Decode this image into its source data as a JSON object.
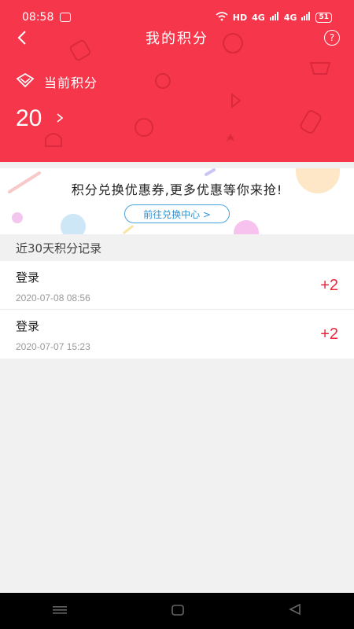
{
  "status_bar": {
    "time": "08:58",
    "network": "HD",
    "signal1": "4G",
    "signal2": "4G",
    "battery": "51"
  },
  "nav": {
    "title": "我的积分",
    "help": "?"
  },
  "points": {
    "label": "当前积分",
    "value": "20"
  },
  "banner": {
    "text": "积分兑换优惠券,更多优惠等你来抢!",
    "button": "前往兑换中心 >"
  },
  "records": {
    "section_title": "近30天积分记录",
    "items": [
      {
        "title": "登录",
        "time": "2020-07-08 08:56",
        "delta": "+2"
      },
      {
        "title": "登录",
        "time": "2020-07-07 15:23",
        "delta": "+2"
      }
    ]
  },
  "colors": {
    "header_bg": "#f6374b",
    "accent_red": "#e8283a",
    "link_blue": "#2b92d5"
  },
  "icons": {
    "back": "back-arrow-icon",
    "help": "question-icon",
    "points": "points-icon",
    "chevron": "chevron-right-icon"
  }
}
